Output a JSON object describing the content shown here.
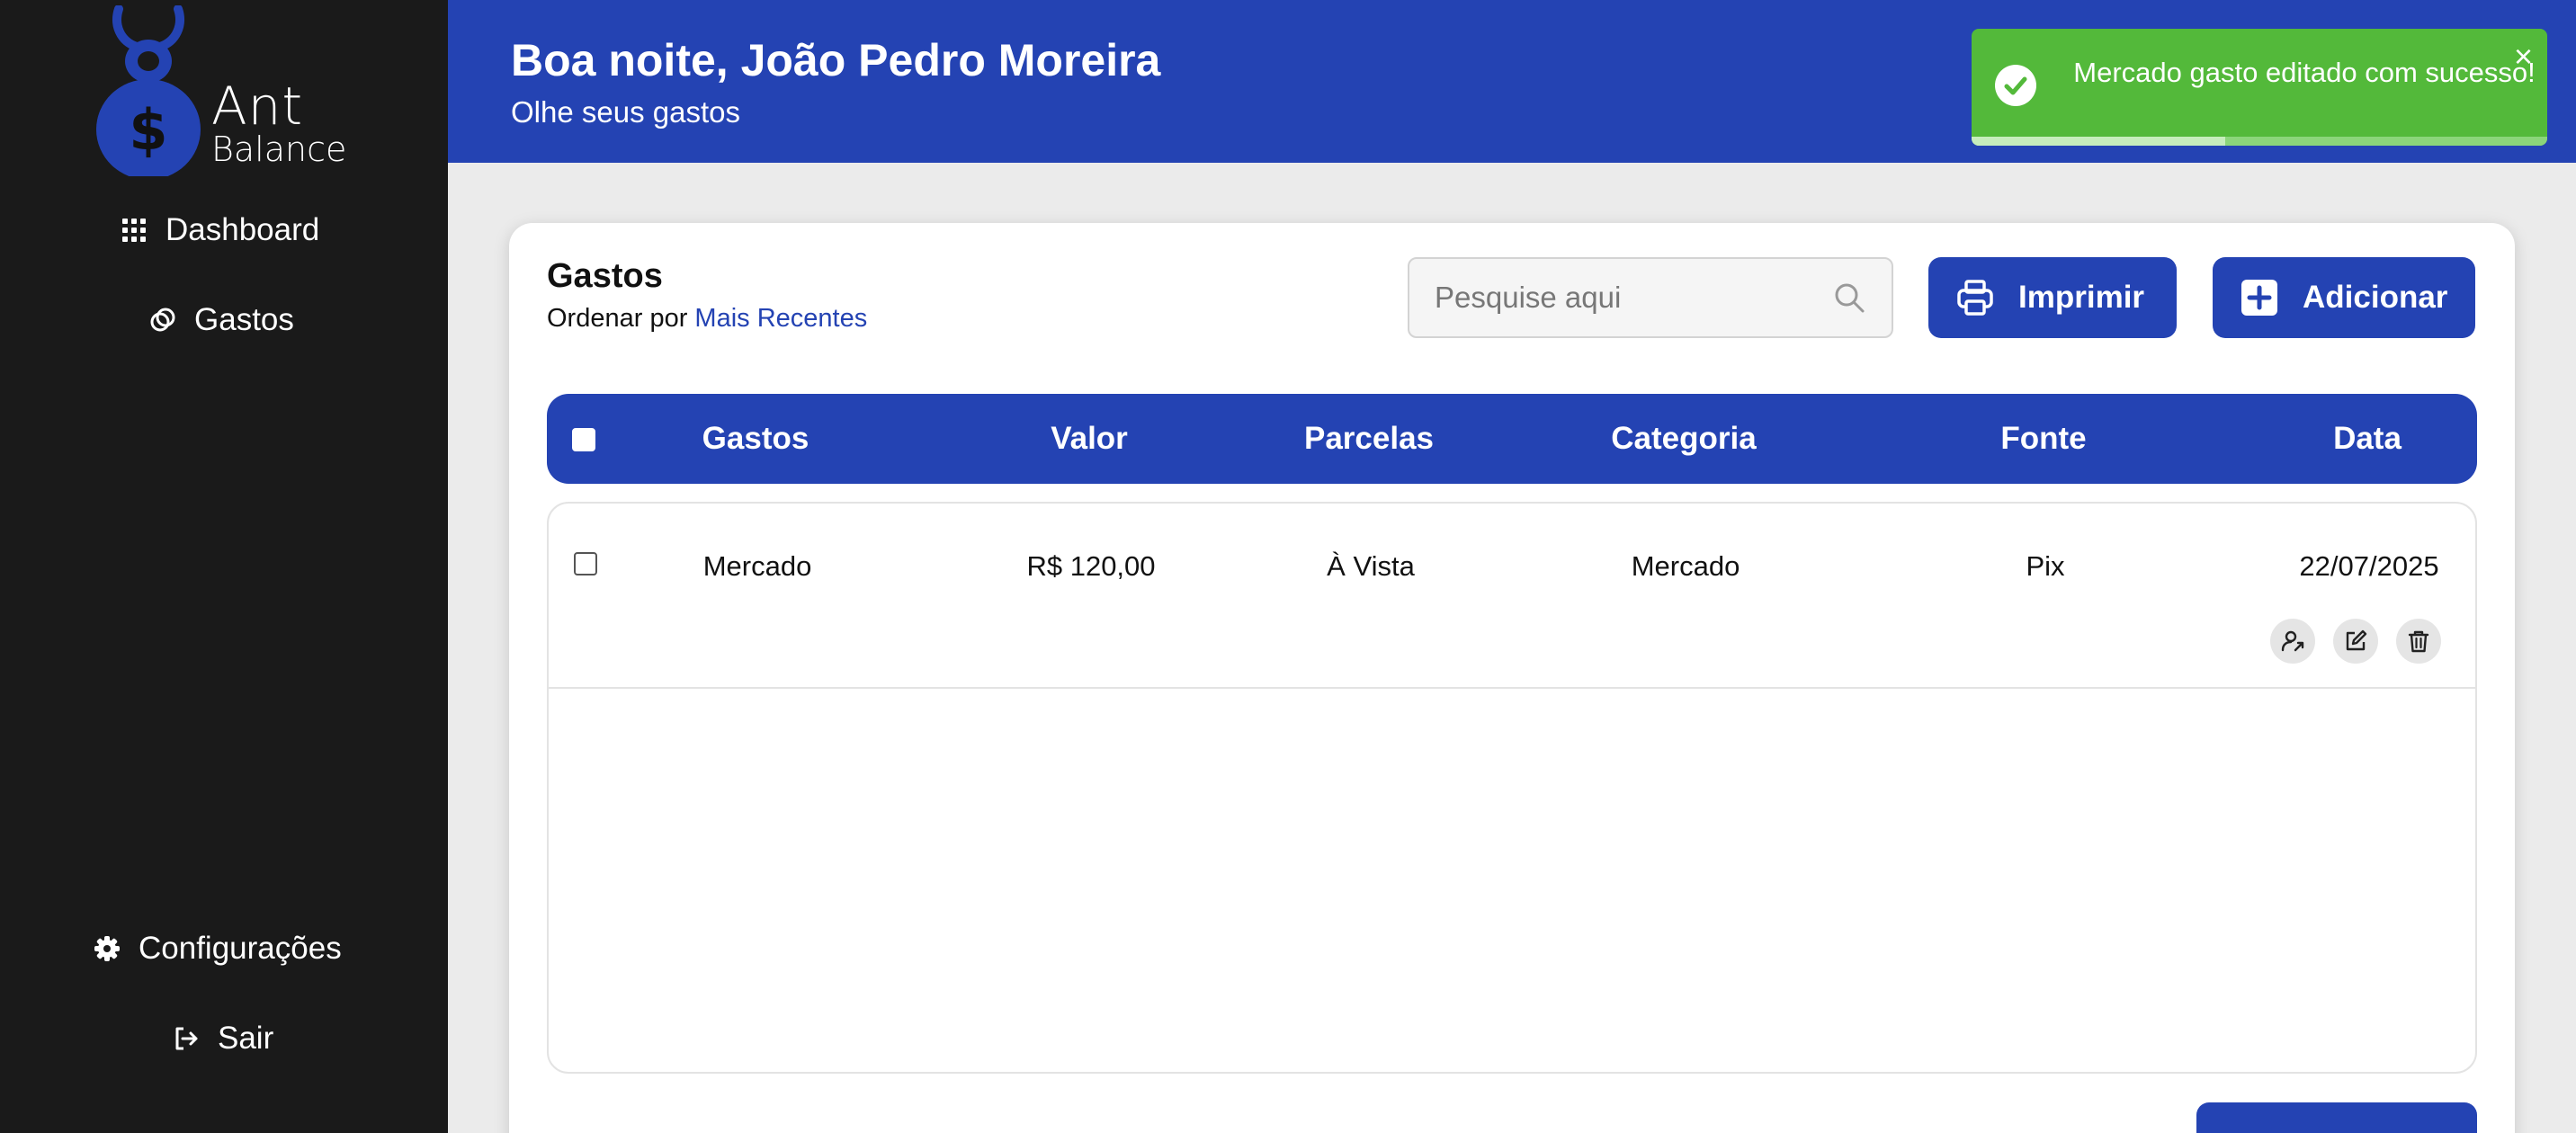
{
  "brand": {
    "name_line1": "Ant",
    "name_line2": "Balance"
  },
  "sidebar": {
    "nav": [
      {
        "label": "Dashboard",
        "icon": "grid-icon"
      },
      {
        "label": "Gastos",
        "icon": "coins-icon"
      }
    ],
    "bottom": [
      {
        "label": "Configurações",
        "icon": "gear-icon"
      },
      {
        "label": "Sair",
        "icon": "logout-icon"
      }
    ]
  },
  "header": {
    "greeting": "Boa noite, João Pedro Moreira",
    "subtitle": "Olhe seus gastos"
  },
  "toast": {
    "message": "Mercado gasto editado com sucesso!",
    "close": "×",
    "progress": 0.44,
    "color": "#53b93a"
  },
  "card": {
    "title": "Gastos",
    "sort_prefix": "Ordenar por",
    "sort_value": "Mais Recentes",
    "search_placeholder": "Pesquise aqui",
    "print_label": "Imprimir",
    "add_label": "Adicionar"
  },
  "table": {
    "headers": [
      "Gastos",
      "Valor",
      "Parcelas",
      "Categoria",
      "Fonte",
      "Data"
    ],
    "rows": [
      {
        "gasto": "Mercado",
        "valor": "R$ 120,00",
        "parcelas": "À Vista",
        "categoria": "Mercado",
        "fonte": "Pix",
        "data": "22/07/2025",
        "selected": false
      }
    ]
  },
  "colors": {
    "primary": "#2443b3",
    "sidebar": "#1a1a1a",
    "background": "#ebebeb"
  }
}
